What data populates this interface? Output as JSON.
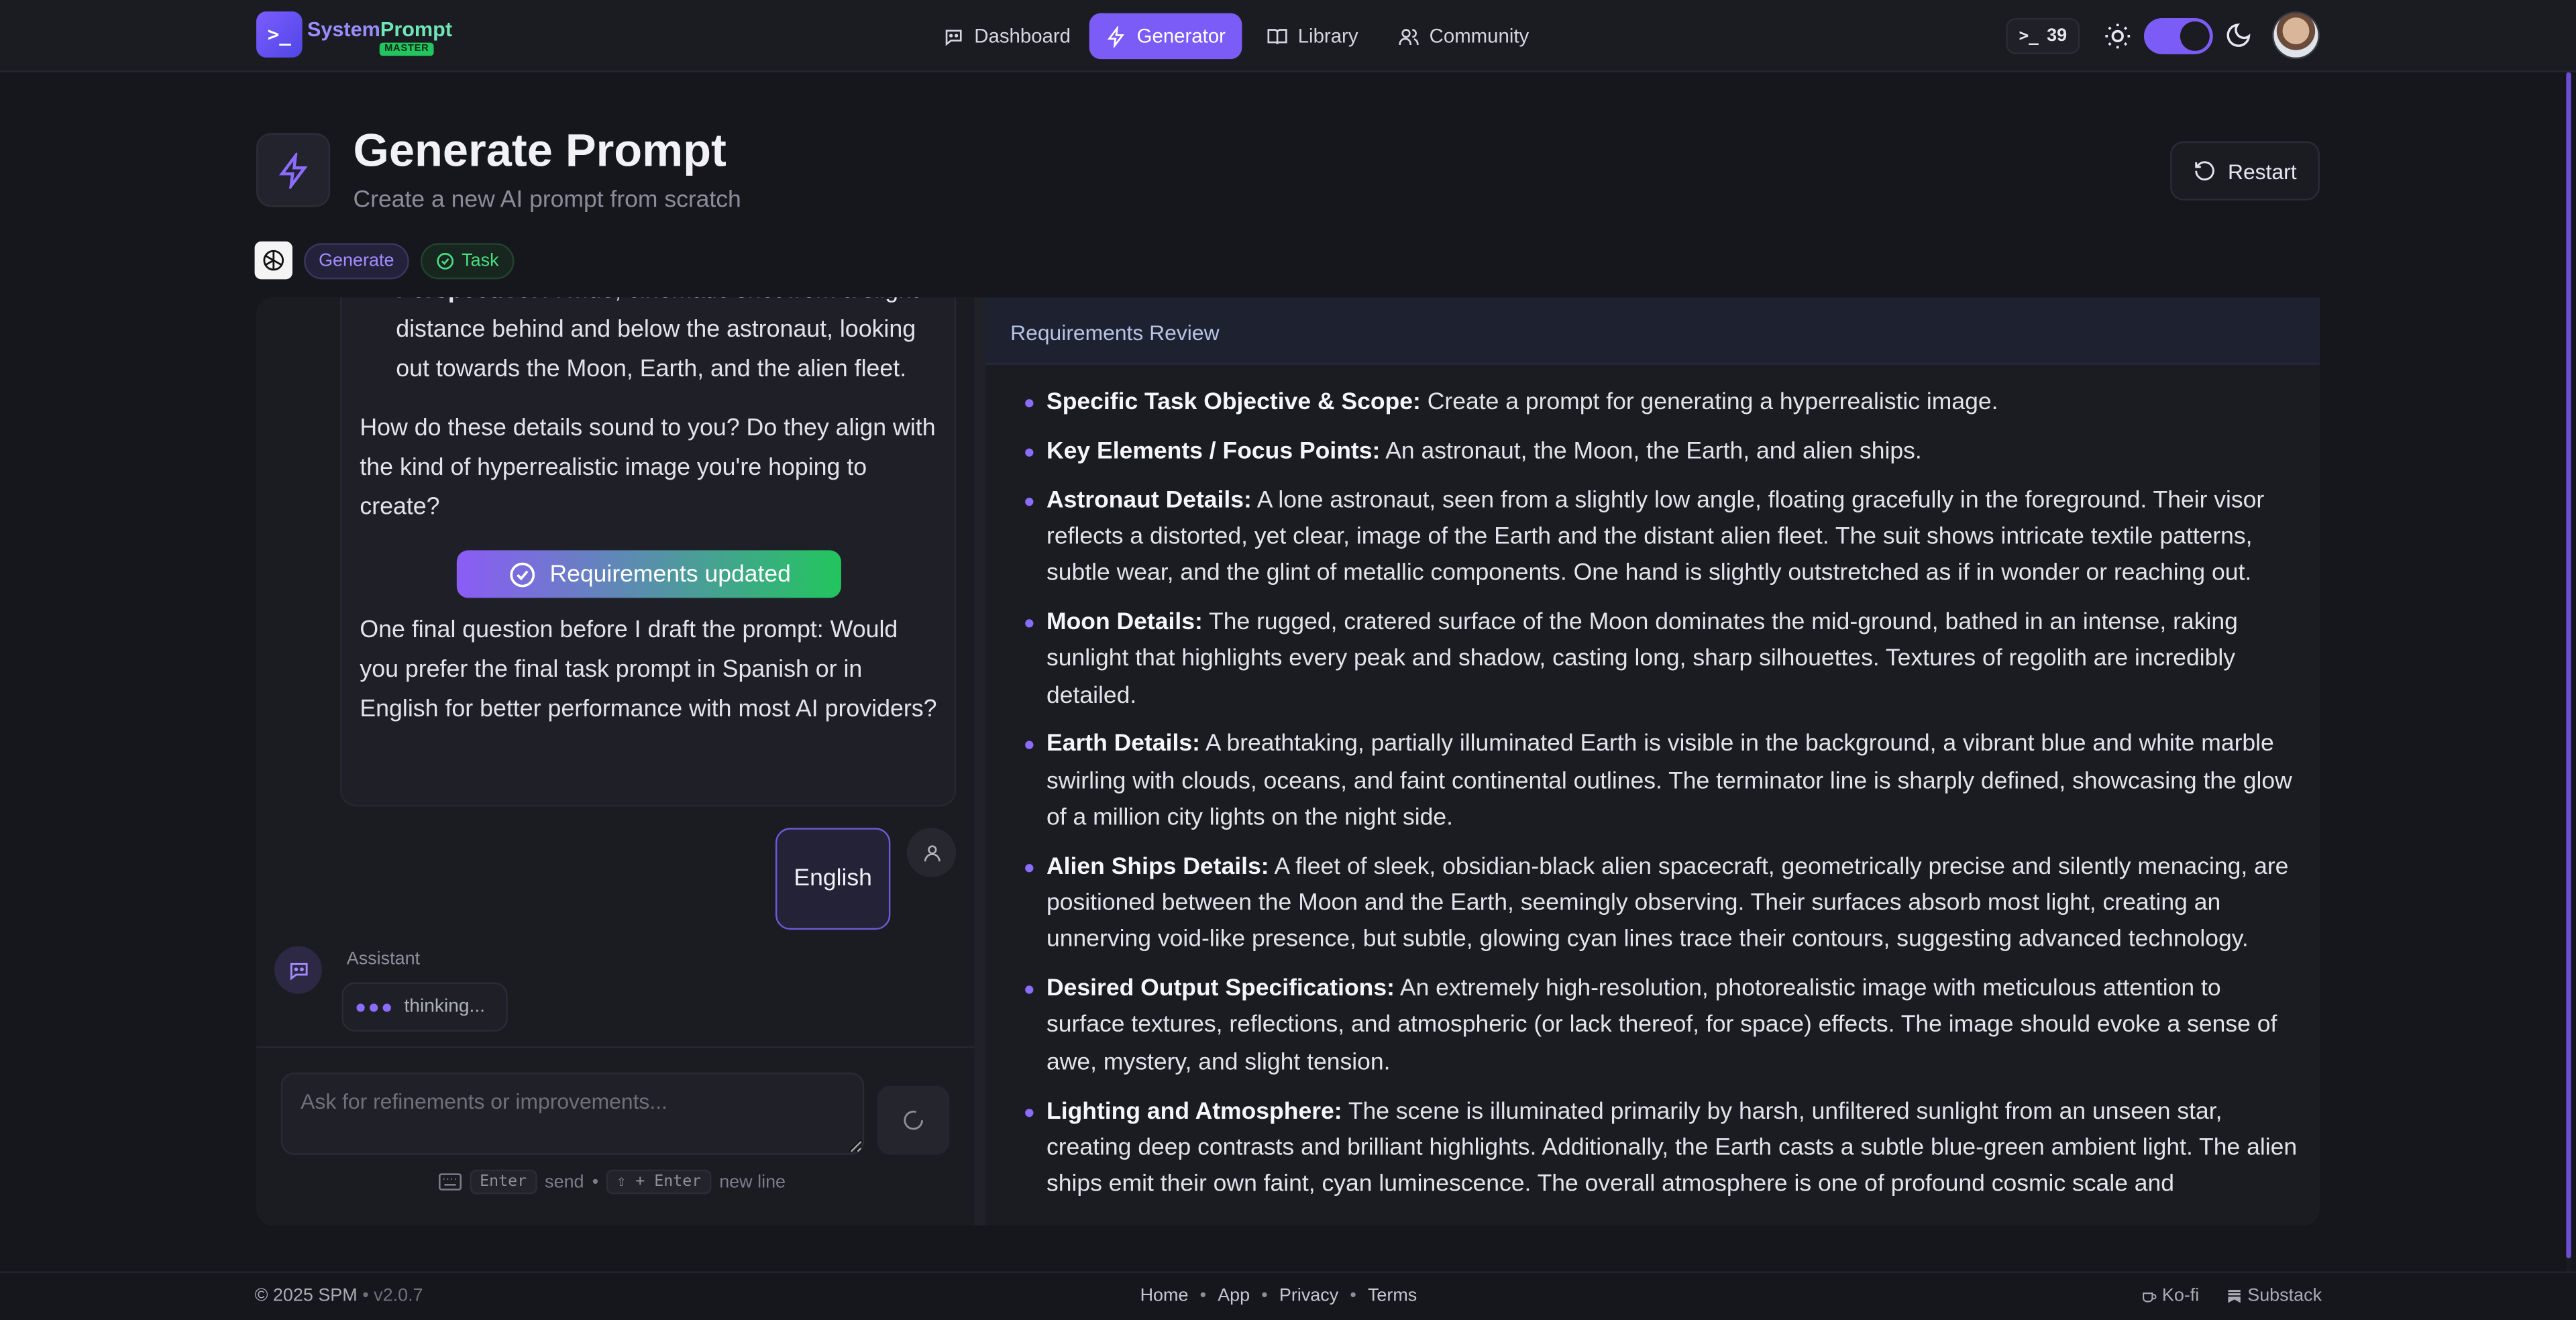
{
  "app": {
    "logo_mark": ">_",
    "name_part1": "System",
    "name_part2": "Prompt",
    "badge": "MASTER"
  },
  "nav": {
    "items": [
      {
        "label": "Dashboard",
        "icon": "chat-bot-icon",
        "active": false
      },
      {
        "label": "Generator",
        "icon": "lightning-icon",
        "active": true
      },
      {
        "label": "Library",
        "icon": "book-icon",
        "active": false
      },
      {
        "label": "Community",
        "icon": "users-icon",
        "active": false
      }
    ],
    "prompt_count": "39",
    "theme_toggle": "dark"
  },
  "header": {
    "title": "Generate Prompt",
    "subtitle": "Create a new AI prompt from scratch",
    "restart_label": "Restart",
    "chips": {
      "generate": "Generate",
      "task": "Task"
    }
  },
  "chat": {
    "bullet_label": "Perspective:",
    "bullet_text": " A wide, cinematic shot from a slight distance behind and below the astronaut, looking out towards the Moon, Earth, and the alien fleet.",
    "question1": "How do these details sound to you? Do they align with the kind of hyperrealistic image you're hoping to create?",
    "requirements_updated": "Requirements updated",
    "question2": "One final question before I draft the prompt: Would you prefer the final task prompt in Spanish or in English for better performance with most AI providers?",
    "user_reply": "English",
    "assistant_label": "Assistant",
    "thinking_label": "thinking...",
    "input_placeholder": "Ask for refinements or improvements...",
    "hint": {
      "enter_key": "Enter",
      "send": "send",
      "shift_enter_key": "⇧ + Enter",
      "new_line": "new line",
      "dot": "•"
    }
  },
  "review": {
    "title": "Requirements Review",
    "items": [
      {
        "label": "Specific Task Objective & Scope:",
        "text": " Create a prompt for generating a hyperrealistic image."
      },
      {
        "label": "Key Elements / Focus Points:",
        "text": " An astronaut, the Moon, the Earth, and alien ships."
      },
      {
        "label": "Astronaut Details:",
        "text": " A lone astronaut, seen from a slightly low angle, floating gracefully in the foreground. Their visor reflects a distorted, yet clear, image of the Earth and the distant alien fleet. The suit shows intricate textile patterns, subtle wear, and the glint of metallic components. One hand is slightly outstretched as if in wonder or reaching out."
      },
      {
        "label": "Moon Details:",
        "text": " The rugged, cratered surface of the Moon dominates the mid-ground, bathed in an intense, raking sunlight that highlights every peak and shadow, casting long, sharp silhouettes. Textures of regolith are incredibly detailed."
      },
      {
        "label": "Earth Details:",
        "text": " A breathtaking, partially illuminated Earth is visible in the background, a vibrant blue and white marble swirling with clouds, oceans, and faint continental outlines. The terminator line is sharply defined, showcasing the glow of a million city lights on the night side."
      },
      {
        "label": "Alien Ships Details:",
        "text": " A fleet of sleek, obsidian-black alien spacecraft, geometrically precise and silently menacing, are positioned between the Moon and the Earth, seemingly observing. Their surfaces absorb most light, creating an unnerving void-like presence, but subtle, glowing cyan lines trace their contours, suggesting advanced technology."
      },
      {
        "label": "Desired Output Specifications:",
        "text": " An extremely high-resolution, photorealistic image with meticulous attention to surface textures, reflections, and atmospheric (or lack thereof, for space) effects. The image should evoke a sense of awe, mystery, and slight tension."
      },
      {
        "label": "Lighting and Atmosphere:",
        "text": " The scene is illuminated primarily by harsh, unfiltered sunlight from an unseen star, creating deep contrasts and brilliant highlights. Additionally, the Earth casts a subtle blue-green ambient light. The alien ships emit their own faint, cyan luminescence. The overall atmosphere is one of profound cosmic scale and"
      }
    ]
  },
  "footer": {
    "copyright": "© 2025 SPM",
    "version": "• v2.0.7",
    "links": [
      "Home",
      "App",
      "Privacy",
      "Terms"
    ],
    "separator": "•",
    "kofi": "Ko-fi",
    "substack": "Substack"
  },
  "colors": {
    "accent": "#7c5cf6",
    "success": "#22c55e",
    "background": "#16171d",
    "panel": "#1b1c22"
  }
}
